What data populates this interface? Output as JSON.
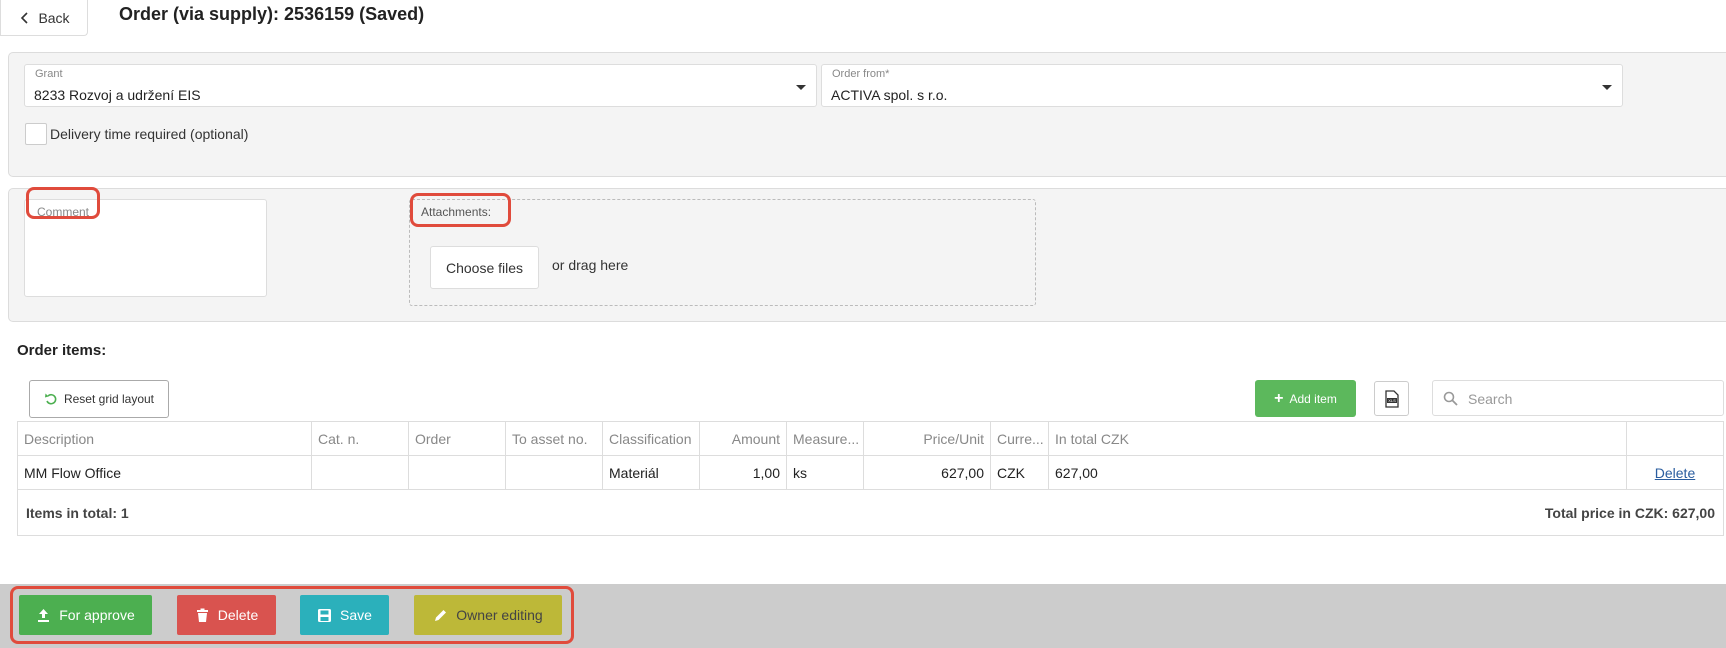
{
  "header": {
    "back_label": "Back",
    "title": "Order (via supply): 2536159 (Saved)"
  },
  "form": {
    "grant": {
      "label": "Grant",
      "value": "8233 Rozvoj a udržení EIS"
    },
    "order_from": {
      "label": "Order from*",
      "value": "ACTIVA spol. s r.o."
    },
    "delivery_checkbox": {
      "label": "Delivery time required (optional)",
      "checked": false
    },
    "comment": {
      "label": "Comment",
      "value": ""
    },
    "attachments": {
      "label": "Attachments:",
      "choose_label": "Choose files",
      "drag_text": "or drag here"
    }
  },
  "order_items": {
    "title": "Order items:",
    "reset_label": "Reset grid layout",
    "add_label": "Add item",
    "search_placeholder": "Search",
    "columns": [
      "Description",
      "Cat. n.",
      "Order",
      "To asset no.",
      "Classification",
      "Amount",
      "Measure...",
      "Price/Unit",
      "Curre...",
      "In total CZK",
      ""
    ],
    "rows": [
      {
        "description": "MM Flow Office",
        "cat_n": "",
        "order": "",
        "to_asset": "",
        "classification": "Materiál",
        "amount": "1,00",
        "measure": "ks",
        "price_unit": "627,00",
        "currency": "CZK",
        "total": "627,00",
        "action": "Delete"
      }
    ],
    "items_total": "Items in total: 1",
    "total_price": "Total price in CZK: 627,00"
  },
  "footer": {
    "approve_label": "For approve",
    "delete_label": "Delete",
    "save_label": "Save",
    "owner_label": "Owner editing"
  },
  "colors": {
    "approve": "#4caf50",
    "delete": "#d9534f",
    "save": "#2bb0bb",
    "owner": "#bdb838",
    "add": "#5cb85c",
    "annotation": "#e04b3c"
  },
  "icons": [
    "chevron-left-icon",
    "caret-down-icon",
    "undo-icon",
    "plus-icon",
    "xls-icon",
    "search-icon",
    "upload-icon",
    "trash-icon",
    "save-icon",
    "pencil-icon"
  ]
}
